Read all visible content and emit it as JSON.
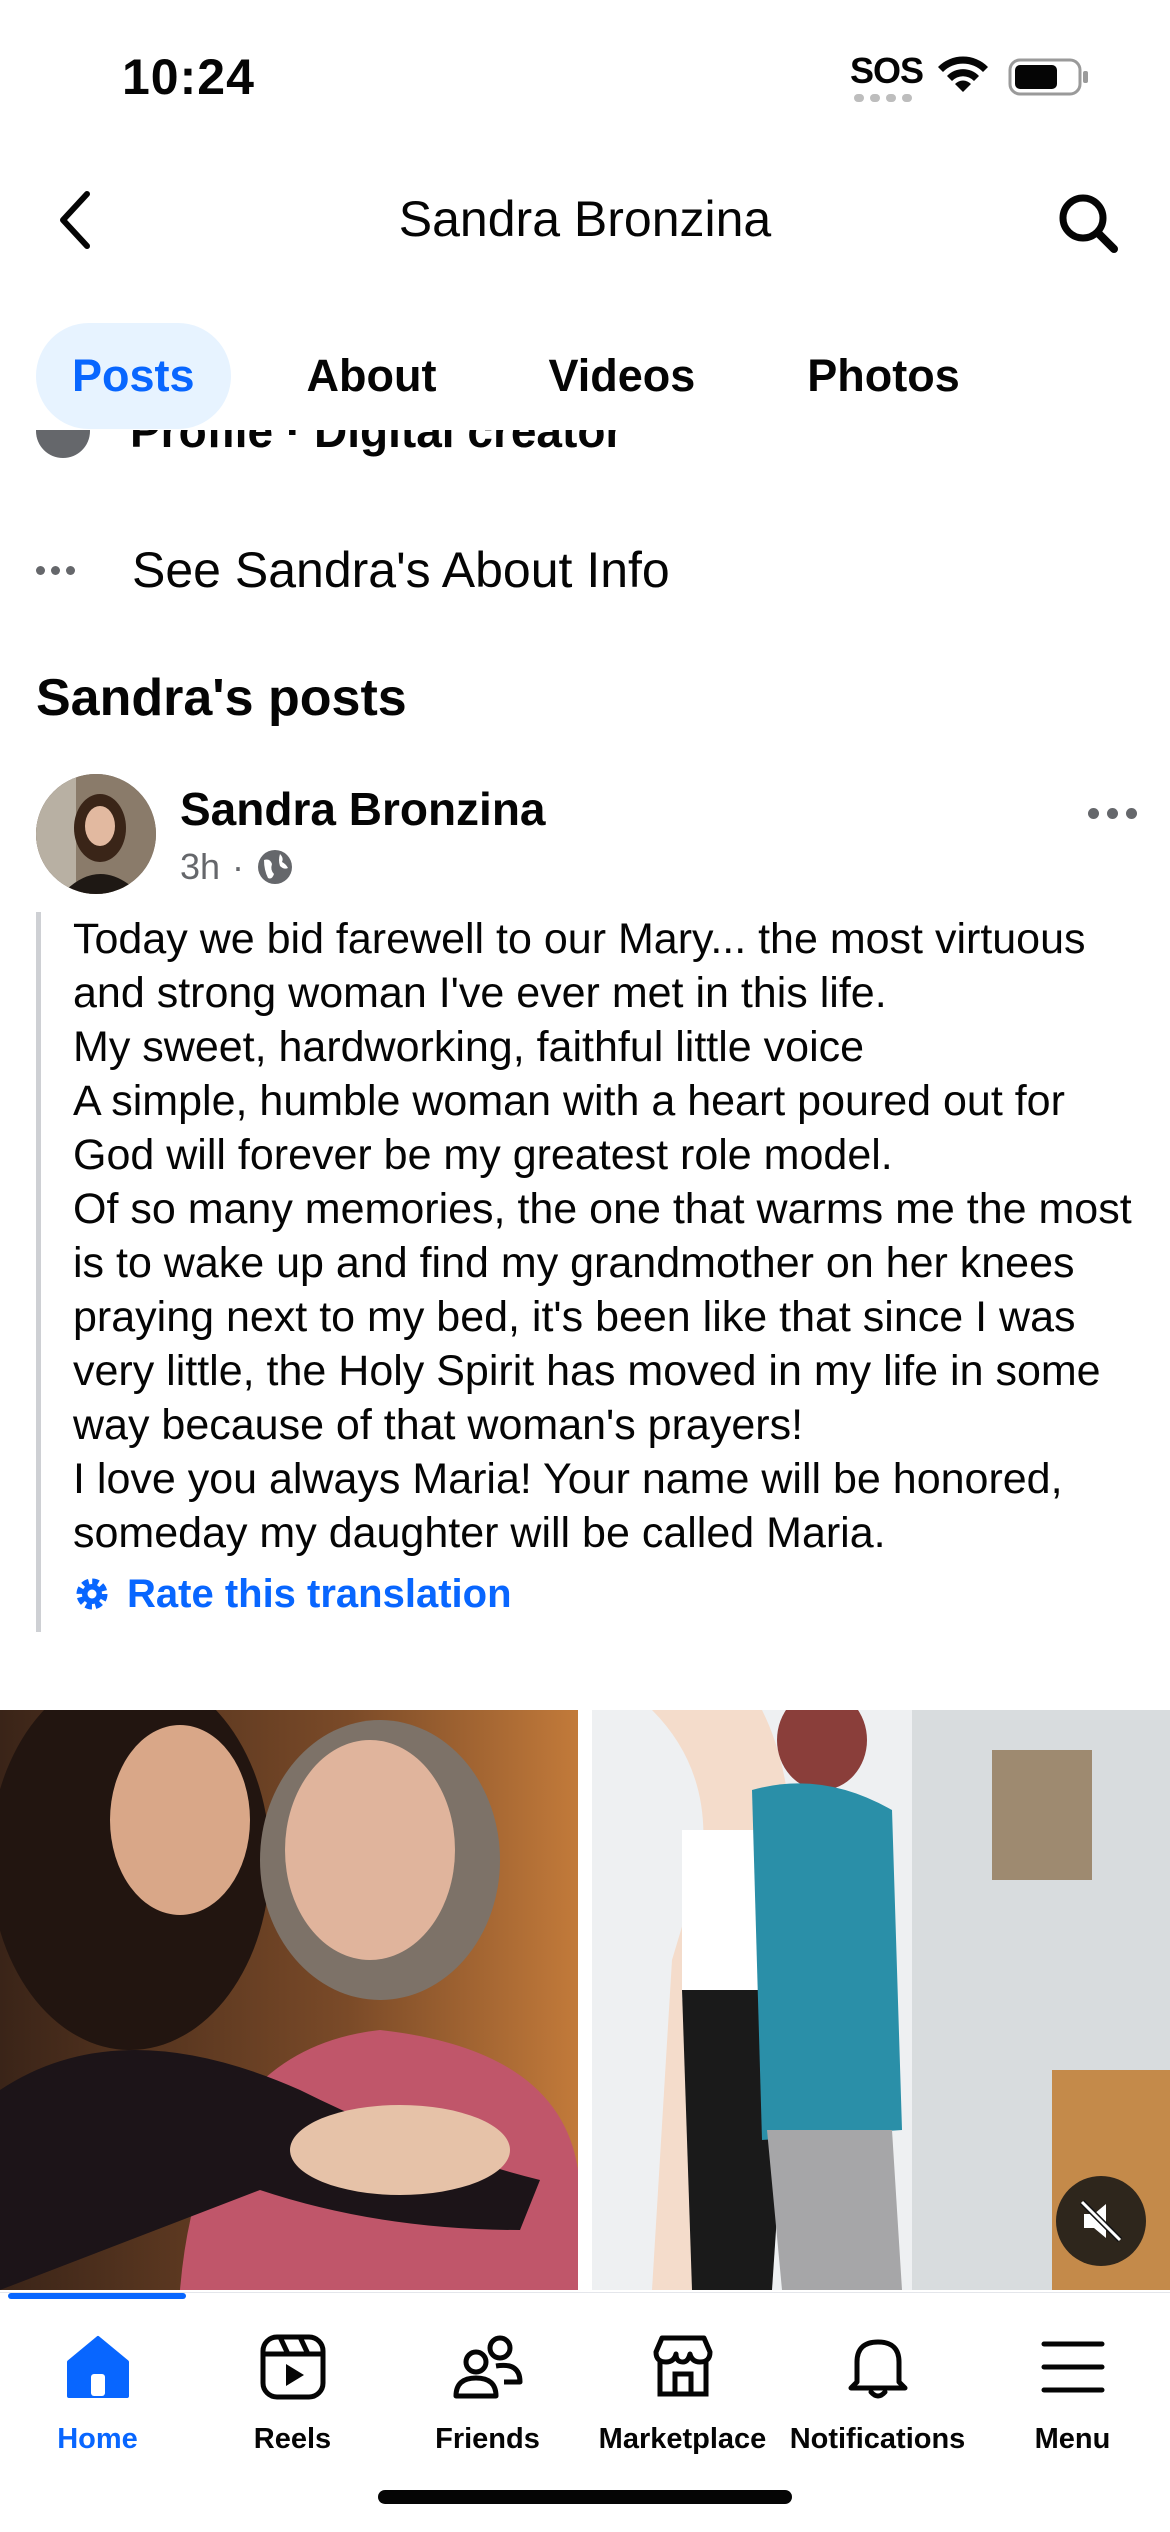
{
  "status_bar": {
    "time": "10:24",
    "sos": "SOS"
  },
  "header": {
    "title": "Sandra Bronzina",
    "back_icon": "chevron-left-icon",
    "search_icon": "search-icon"
  },
  "tabs": [
    {
      "label": "Posts",
      "active": true
    },
    {
      "label": "About",
      "active": false
    },
    {
      "label": "Videos",
      "active": false
    },
    {
      "label": "Photos",
      "active": false
    }
  ],
  "intro": {
    "cut_off_line": "Profile · Digital creator",
    "about_link": "See Sandra's About Info"
  },
  "section_title": "Sandra's posts",
  "post": {
    "author": "Sandra Bronzina",
    "time": "3h",
    "separator": "·",
    "audience_icon": "globe-icon",
    "text": "Today we bid farewell to our Mary... the most virtuous and strong woman I've ever met in this life.\nMy sweet, hardworking, faithful little voice\nA simple, humble woman with a heart poured out for God will forever be my greatest role model.\nOf so many memories, the one that warms me the most is to wake up and find my grandmother on her knees praying next to my bed, it's been like that since I was very little, the Holy Spirit has moved in my life in some way because of that woman's prayers!\nI love you always Maria! Your name will be honored, someday my daughter will be called Maria.",
    "rate_translation": "Rate this translation"
  },
  "bottom_nav": [
    {
      "label": "Home",
      "icon": "home-icon",
      "active": true
    },
    {
      "label": "Reels",
      "icon": "reels-icon",
      "active": false
    },
    {
      "label": "Friends",
      "icon": "friends-icon",
      "active": false
    },
    {
      "label": "Marketplace",
      "icon": "marketplace-icon",
      "active": false
    },
    {
      "label": "Notifications",
      "icon": "bell-icon",
      "active": false
    },
    {
      "label": "Menu",
      "icon": "menu-icon",
      "active": false
    }
  ],
  "colors": {
    "accent": "#0866ff",
    "tab_active_bg": "#e7f3ff",
    "secondary_text": "#65676b"
  }
}
